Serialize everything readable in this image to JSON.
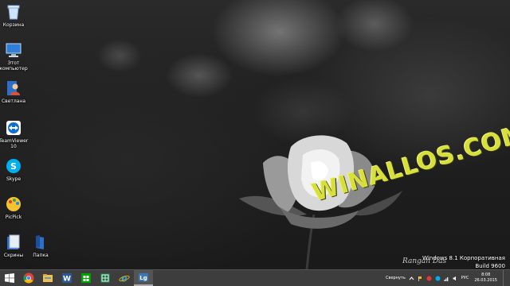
{
  "desktop_icons": [
    {
      "label": "Корзина"
    },
    {
      "label": "Этот компьютер"
    },
    {
      "label": "Светлана"
    },
    {
      "label": "TeamViewer 10"
    },
    {
      "label": "Skype"
    },
    {
      "label": "PicPick"
    },
    {
      "label": "Скрины"
    },
    {
      "label": "Папка"
    }
  ],
  "watermark": "WINALLOS.COM",
  "signature": "Rangan Das",
  "windows_info": {
    "line1": "Windows 8.1 Корпоративная",
    "line2": "Build 9600"
  },
  "taskbar": {
    "apps": [
      {
        "icon": "chrome-icon"
      },
      {
        "icon": "file-explorer-icon"
      },
      {
        "icon": "word-icon"
      },
      {
        "icon": "store-icon"
      },
      {
        "icon": "excel-icon"
      },
      {
        "icon": "internet-explorer-icon"
      },
      {
        "icon": "dictionary-icon"
      }
    ],
    "tray_label": "Свернуть",
    "language": "РУС",
    "time": "8:08",
    "date": "26.03.2015"
  },
  "colors": {
    "watermark": "#d7df3c",
    "taskbar": "#3d3d3d"
  }
}
